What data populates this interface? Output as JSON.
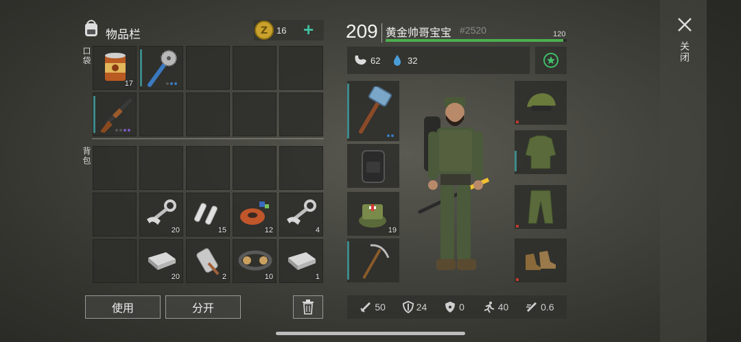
{
  "inventory": {
    "title": "物品栏",
    "coins": "16",
    "pocket_label": "口袋",
    "backpack_label": "背包",
    "pocket_items": [
      {
        "name": "canned-food",
        "qty": "17"
      },
      {
        "name": "saw-mace",
        "qty": ""
      },
      {
        "name": "shotgun",
        "qty": ""
      }
    ],
    "backpack_items": [
      {
        "name": "connecting-rod",
        "qty": "20"
      },
      {
        "name": "fuses",
        "qty": "15"
      },
      {
        "name": "copper-coil",
        "qty": "12"
      },
      {
        "name": "connecting-rod",
        "qty": "4"
      },
      {
        "name": "ecu-board",
        "qty": "20"
      },
      {
        "name": "starter-motor",
        "qty": "2"
      },
      {
        "name": "timing-belt",
        "qty": "10"
      },
      {
        "name": "ecu-board",
        "qty": "1"
      }
    ],
    "use_label": "使用",
    "split_label": "分开"
  },
  "character": {
    "level": "209",
    "name": "黄金帅哥宝宝",
    "id": "#2520",
    "xp_max": "120",
    "xp_fraction": 0.98,
    "hunger": "62",
    "water": "32",
    "med_qty": "19"
  },
  "stats": {
    "damage": "50",
    "armor": "24",
    "radiation": "0",
    "speed": "40",
    "attack_speed": "0.6"
  },
  "close_label": "关闭",
  "colors": {
    "accent": "#3fbf6a",
    "teal": "#3d8a8a",
    "xp": "#4caf50"
  }
}
